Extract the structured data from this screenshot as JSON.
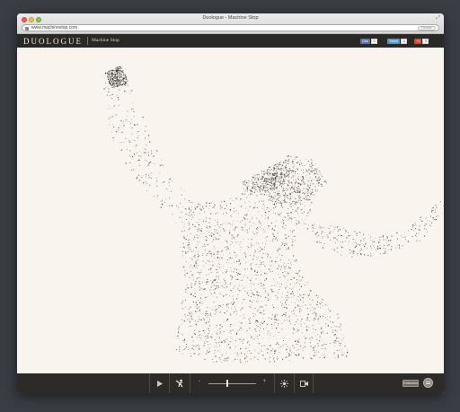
{
  "window": {
    "title": "Duologue - Machine Stop",
    "url": "www.machinestop.com",
    "reader_label": "Reader"
  },
  "header": {
    "logo": "DUOLOGUE",
    "subtitle": "Machine Stop"
  },
  "social": {
    "like_label": "Like",
    "like_count": "0",
    "tweet_label": "Tweet",
    "tweet_count": "0",
    "gplus_label": "+1",
    "gplus_count": "0"
  },
  "toolbar": {
    "play_icon": "play-icon",
    "pose_icon": "figure-pose-icon",
    "zoom_minus": "-",
    "zoom_plus": "+",
    "zoom_level": 0.38,
    "light_icon": "sun-icon",
    "camera_icon": "camera-icon",
    "fullscreen_label": "Fullscreen",
    "sound_icon": "sound-icon"
  },
  "colors": {
    "background": "#3b3d45",
    "canvas": "#f9f5ee",
    "header": "#2a2926",
    "dots": "#2b2b2b"
  }
}
